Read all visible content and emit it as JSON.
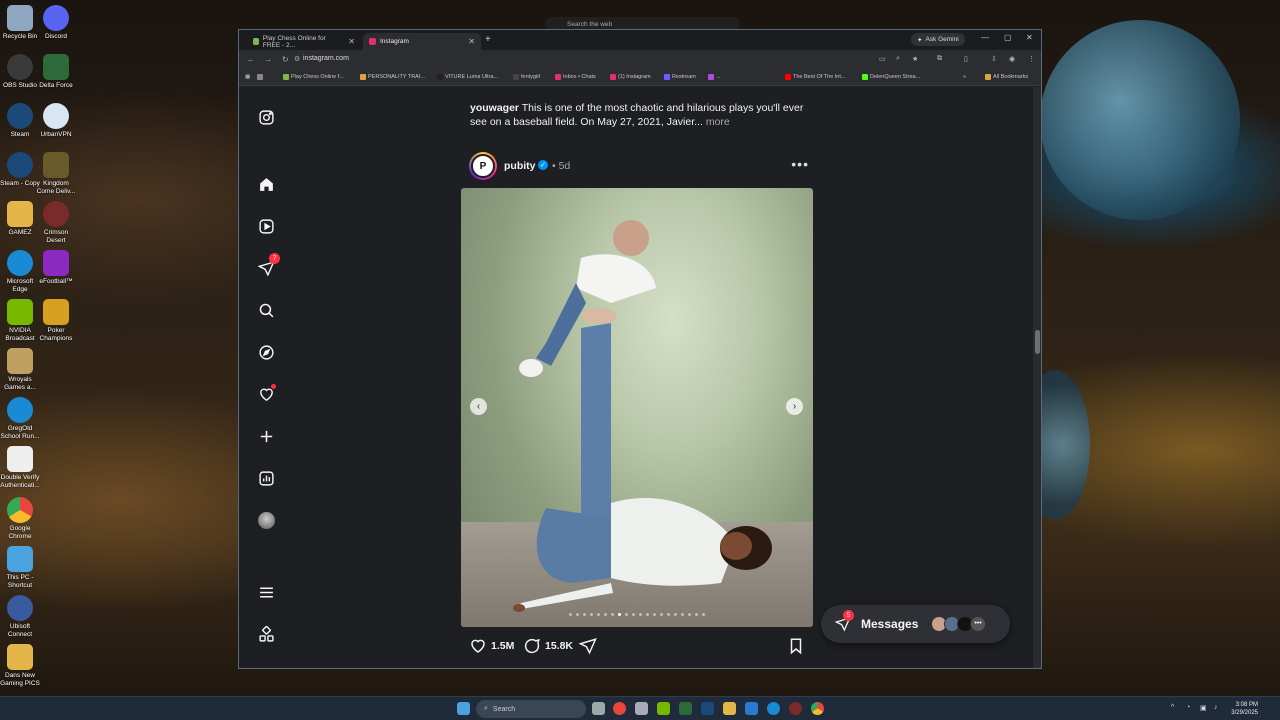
{
  "desktop": {
    "top_search_placeholder": "Search the web",
    "icons": [
      {
        "label": "Recycle Bin",
        "color": "#8fa7c0"
      },
      {
        "label": "Discord",
        "color": "#5865f2"
      },
      {
        "label": "OBS Studio",
        "color": "#3a3a3a"
      },
      {
        "label": "Delta Force",
        "color": "#2d6a3a"
      },
      {
        "label": "Steam",
        "color": "#1b4a7a"
      },
      {
        "label": "UrbanVPN",
        "color": "#d8e6f3"
      },
      {
        "label": "Steam - Copy",
        "color": "#1b4a7a"
      },
      {
        "label": "Kingdom Come Deliv...",
        "color": "#6a5a2a"
      },
      {
        "label": "GAMEZ",
        "color": "#e4b64a"
      },
      {
        "label": "Crimson Desert",
        "color": "#7a2a2a"
      },
      {
        "label": "Microsoft Edge",
        "color": "#1a8ad4"
      },
      {
        "label": "eFootball™",
        "color": "#8a2ac0"
      },
      {
        "label": "NVIDIA Broadcast",
        "color": "#76b900"
      },
      {
        "label": "Poker Champions",
        "color": "#d8a020"
      },
      {
        "label": "Wroyals Games a...",
        "color": "#c0a060"
      },
      {
        "label": "GregOld School Run...",
        "color": "#1a8ad4"
      },
      {
        "label": "Double Verify Authenticati...",
        "color": "#eeeeee"
      },
      {
        "label": "Google Chrome",
        "color": "#e8453c"
      },
      {
        "label": "This PC - Shortcut",
        "color": "#4aa3df"
      },
      {
        "label": "Ubisoft Connect",
        "color": "#3a5aa0"
      },
      {
        "label": "Dans New Gaming PICS",
        "color": "#e4b64a"
      }
    ]
  },
  "browser": {
    "tabs": [
      {
        "label": "Play Chess Online for FREE - 2...",
        "favicon_color": "#81b64c"
      },
      {
        "label": "Instagram",
        "favicon_color": "#e1306c"
      }
    ],
    "new_tab": "+",
    "ask_gemini": "Ask Gemini",
    "window_controls": {
      "minimize": "—",
      "maximize": "▢",
      "close": "✕"
    },
    "url": "instagram.com",
    "bookmarks": [
      {
        "label": "Play Chess Online f...",
        "color": "#81b64c"
      },
      {
        "label": "PERSONALITY TRAI...",
        "color": "#d9a441"
      },
      {
        "label": "VITURE Luma Ultra...",
        "color": "#222222"
      },
      {
        "label": "fentygirl",
        "color": "#444444"
      },
      {
        "label": "Inbox • Chats",
        "color": "#e1306c"
      },
      {
        "label": "(1) Instagram",
        "color": "#e1306c"
      },
      {
        "label": "Restream",
        "color": "#6f5cff"
      },
      {
        "label": "...",
        "color": "#b04ad8"
      },
      {
        "label": "The Best Of The Int...",
        "color": "#ff0000"
      },
      {
        "label": "DelenQueen Strea...",
        "color": "#53fc18"
      }
    ],
    "all_bookmarks": "All Bookmarks"
  },
  "instagram": {
    "caption": {
      "username": "youwager",
      "text": "This is one of the most chaotic and hilarious plays you'll ever see on a baseball field. On May 27, 2021, Javier...",
      "more": "more"
    },
    "post": {
      "username": "pubity",
      "verified_mark": "✓",
      "age": "• 5d",
      "avatar_letter": "P",
      "likes": "1.5M",
      "comments": "15.8K",
      "carousel_pages": 20,
      "carousel_active": 7
    },
    "nav_badges": {
      "reels_share": "7"
    },
    "messages": {
      "label": "Messages",
      "badge": "5"
    }
  },
  "taskbar": {
    "search_label": "Search",
    "time": "3:08 PM",
    "date": "3/29/2025"
  }
}
